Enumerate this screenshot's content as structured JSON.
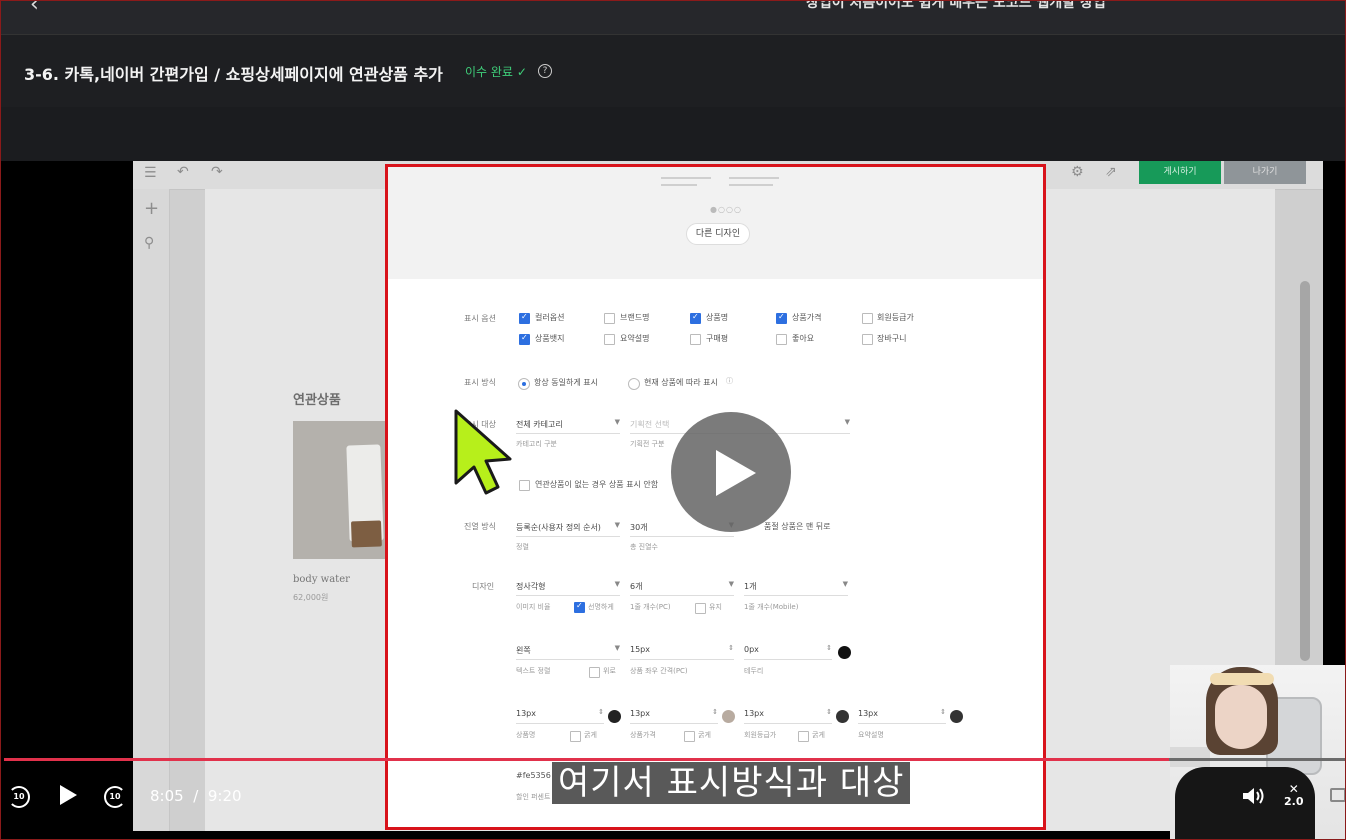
{
  "header": {
    "back_icon": "chevron-left-icon",
    "course_title": "창업이 처음이어도 쉽게 배우는 노코드 웹개발 창업",
    "lesson_title": "3-6. 카톡,네이버 간편가입 / 쇼핑상세페이지에 연관상품 추가",
    "status_label": "이수 완료",
    "status_color": "#3fcf7a",
    "help_icon": "question-circle-icon"
  },
  "editor": {
    "publish_label": "게시하기",
    "exit_label": "나가기",
    "related_title": "연관상품",
    "product_name": "body water",
    "product_price": "62,000원"
  },
  "panel": {
    "other_design_label": "다른 디자인",
    "display_options_label": "표시 옵션",
    "options": [
      {
        "label": "컬러옵션",
        "checked": true
      },
      {
        "label": "브랜드명",
        "checked": false
      },
      {
        "label": "상품명",
        "checked": true
      },
      {
        "label": "상품가격",
        "checked": true
      },
      {
        "label": "회원등급가",
        "checked": false
      },
      {
        "label": "상품뱃지",
        "checked": true
      },
      {
        "label": "요약설명",
        "checked": false
      },
      {
        "label": "구매평",
        "checked": false
      },
      {
        "label": "좋아요",
        "checked": false
      },
      {
        "label": "장바구니",
        "checked": false
      }
    ],
    "display_method_label": "표시 방식",
    "method_always": "항상 동일하게 표시",
    "method_by_product": "현재 상품에 따라 표시",
    "display_target_label": "표시 대상",
    "category_value": "전체 카테고리",
    "category_sub": "카테고리 구분",
    "exhibition_placeholder": "기획전 선택",
    "exhibition_sub": "기획전 구분",
    "hide_when_empty": "연관상품이 없는 경우 상품 표시 안함",
    "arrange_label": "진열 방식",
    "sort_value": "등록순(사용자 정의 순서)",
    "sort_sub": "정렬",
    "count_value": "30개",
    "count_sub": "총 진열수",
    "soldout_back": "품절 상품은 맨 뒤로",
    "design_label": "디자인",
    "shape_value": "정사각형",
    "ratio_sub": "이미지 비율",
    "clear_label": "선명하게",
    "cols_pc_value": "6개",
    "cols_pc_sub": "1줄 개수(PC)",
    "keep_label": "유지",
    "cols_mobile_value": "1개",
    "cols_mobile_sub": "1줄 개수(Mobile)",
    "align_value": "왼쪽",
    "align_sub": "텍스트 정렬",
    "above_label": "위로",
    "gap_value": "15px",
    "gap_sub": "상품 좌우 간격(PC)",
    "border_value": "0px",
    "border_sub": "테두리",
    "font_sizes": [
      "13px",
      "13px",
      "13px",
      "13px"
    ],
    "font_subs": [
      "상품명",
      "상품가격",
      "회원등급가",
      "요약설명"
    ],
    "bold_label": "굵게",
    "discount_color_value": "#fe5356",
    "discount_sub": "할인 퍼센트",
    "swatch_colors": [
      "#111111",
      "#222222",
      "#b8aba0",
      "#333333",
      "#333333"
    ]
  },
  "player": {
    "play_icon": "play-icon",
    "current_time": "8:05",
    "separator": "/",
    "duration": "9:20",
    "progress_fraction": 0.868,
    "skip_back_label": "10",
    "skip_forward_label": "10",
    "speed": "2.0",
    "speed_icon": "close-icon",
    "volume_icon": "volume-icon",
    "subtitle_icon": "subtitles-icon",
    "caption_text": "여기서 표시방식과 대상",
    "accent_color": "#e1314b"
  }
}
